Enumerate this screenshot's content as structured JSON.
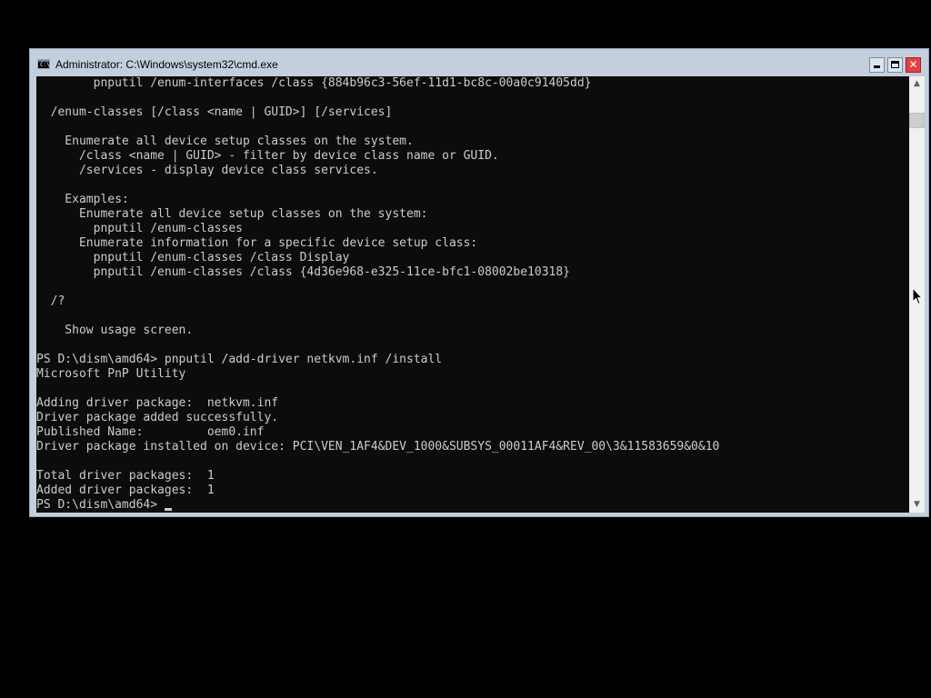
{
  "window": {
    "title": "Administrator: C:\\Windows\\system32\\cmd.exe",
    "icon": "console-icon",
    "icon_glyph": "C:\\"
  },
  "titlebar_buttons": {
    "minimize": "minimize-icon",
    "maximize": "maximize-icon",
    "close": "close-icon",
    "close_glyph": "✕"
  },
  "console": {
    "background": "#0c0c0c",
    "foreground": "#cccccc",
    "lines": [
      "        pnputil /enum-interfaces /class {884b96c3-56ef-11d1-bc8c-00a0c91405dd}",
      "",
      "  /enum-classes [/class <name | GUID>] [/services]",
      "",
      "    Enumerate all device setup classes on the system.",
      "      /class <name | GUID> - filter by device class name or GUID.",
      "      /services - display device class services.",
      "",
      "    Examples:",
      "      Enumerate all device setup classes on the system:",
      "        pnputil /enum-classes",
      "      Enumerate information for a specific device setup class:",
      "        pnputil /enum-classes /class Display",
      "        pnputil /enum-classes /class {4d36e968-e325-11ce-bfc1-08002be10318}",
      "",
      "  /?",
      "",
      "    Show usage screen.",
      "",
      "PS D:\\dism\\amd64> pnputil /add-driver netkvm.inf /install",
      "Microsoft PnP Utility",
      "",
      "Adding driver package:  netkvm.inf",
      "Driver package added successfully.",
      "Published Name:         oem0.inf",
      "Driver package installed on device: PCI\\VEN_1AF4&DEV_1000&SUBSYS_00011AF4&REV_00\\3&11583659&0&10",
      "",
      "Total driver packages:  1",
      "Added driver packages:  1"
    ],
    "prompt": "PS D:\\dism\\amd64>"
  },
  "scrollbar": {
    "up_glyph": "▲",
    "down_glyph": "▼",
    "position": 0.08
  },
  "pointer": "mouse-pointer-icon"
}
